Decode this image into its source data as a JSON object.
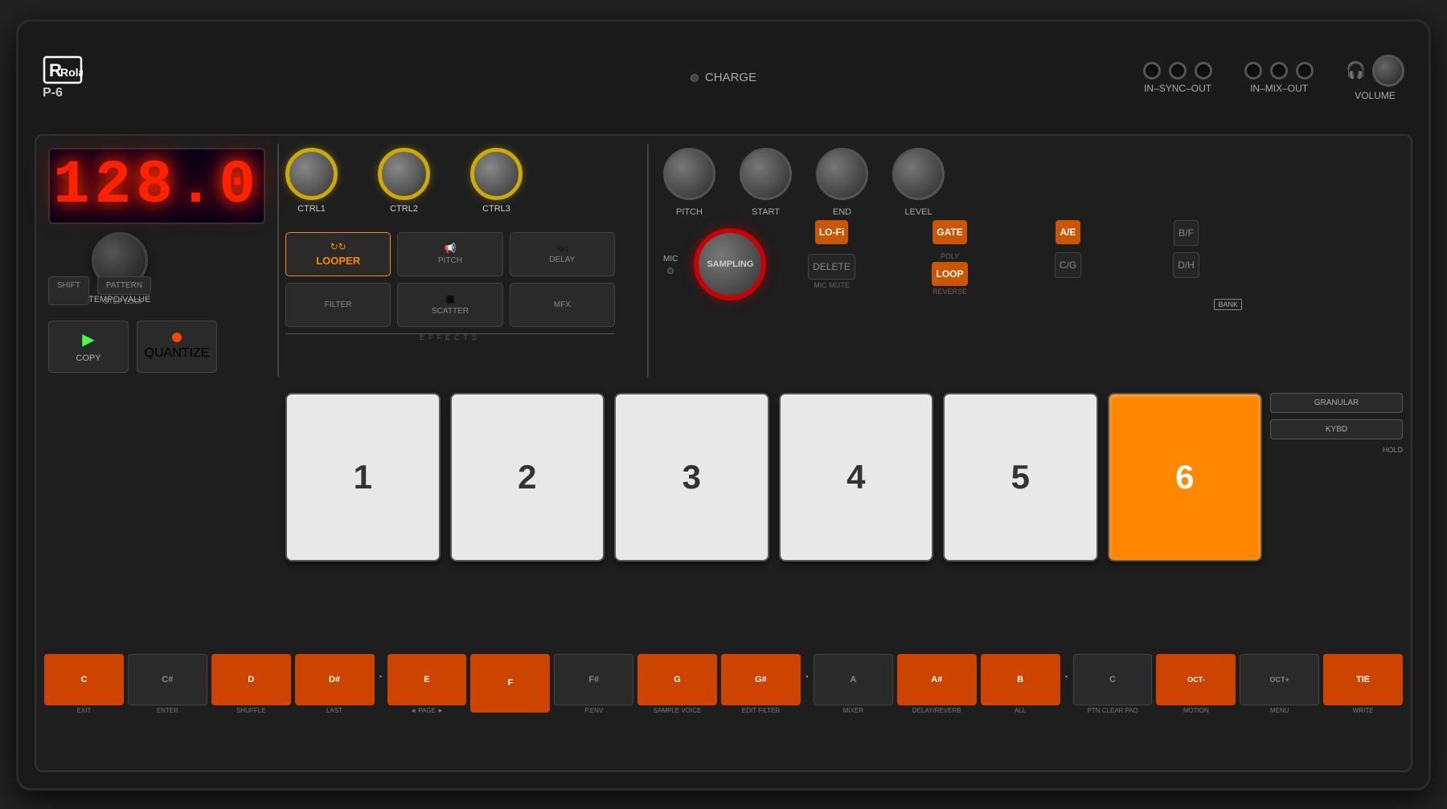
{
  "device": {
    "brand": "Roland",
    "model": "P-6",
    "brand_icon": "R"
  },
  "top_bar": {
    "charge_label": "CHARGE",
    "sync_label": "IN–SYNC–OUT",
    "mix_label": "IN–MIX–OUT",
    "volume_label": "VOLUME"
  },
  "display": {
    "value": "128.0"
  },
  "tempo": {
    "label": "TEMPO/VALUE"
  },
  "buttons": {
    "shift": "SHIFT",
    "pattern": "PATTERN",
    "step_loop": "STEP LOOP",
    "copy": "COPY",
    "quantize": "QUANTIZE"
  },
  "ctrl_knobs": [
    {
      "label": "CTRL1"
    },
    {
      "label": "CTRL2"
    },
    {
      "label": "CTRL3"
    }
  ],
  "effects": {
    "label": "EFFECTS",
    "buttons": [
      {
        "name": "LOOPER",
        "icon": "↻",
        "active": true
      },
      {
        "name": "PITCH",
        "icon": "♪",
        "active": false
      },
      {
        "name": "DELAY",
        "icon": "◁◁",
        "active": false
      },
      {
        "name": "FILTER",
        "icon": "",
        "active": false
      },
      {
        "name": "SCATTER",
        "icon": "▦",
        "active": false
      },
      {
        "name": "MFX",
        "icon": "",
        "active": false
      }
    ]
  },
  "right_knobs": [
    {
      "label": "PITCH",
      "size": "lg"
    },
    {
      "label": "START",
      "size": "lg"
    },
    {
      "label": "END",
      "size": "lg"
    },
    {
      "label": "LEVEL",
      "size": "lg"
    }
  ],
  "mic": {
    "label": "MIC"
  },
  "sampling": {
    "label": "SAMPLING"
  },
  "right_buttons": [
    {
      "label": "LO-Fi",
      "type": "orange",
      "sublabel": ""
    },
    {
      "label": "GATE",
      "type": "orange",
      "sublabel": ""
    },
    {
      "label": "A/E",
      "type": "orange",
      "sublabel": ""
    },
    {
      "label": "B/F",
      "type": "dark",
      "sublabel": ""
    },
    {
      "label": "DELETE",
      "type": "dark",
      "sublabel": "MIC MUTE"
    },
    {
      "label": "LOOP",
      "type": "orange",
      "sublabel": "POLY\nREVERSE"
    },
    {
      "label": "C/G",
      "type": "dark",
      "sublabel": ""
    },
    {
      "label": "D/H",
      "type": "dark",
      "sublabel": ""
    }
  ],
  "pads": [
    {
      "number": "1",
      "active": false
    },
    {
      "number": "2",
      "active": false
    },
    {
      "number": "3",
      "active": false
    },
    {
      "number": "4",
      "active": false
    },
    {
      "number": "5",
      "active": false
    },
    {
      "number": "6",
      "active": true
    }
  ],
  "side_buttons": [
    {
      "label": "GRANULAR"
    },
    {
      "label": "KYBD"
    },
    {
      "label": "HOLD"
    }
  ],
  "bottom_keys": [
    {
      "note": "C",
      "type": "orange",
      "sublabel": "EXIT"
    },
    {
      "note": "C#",
      "type": "dark",
      "sublabel": "ENTER"
    },
    {
      "note": "D",
      "type": "orange",
      "sublabel": "SHUFFLE"
    },
    {
      "note": "D#",
      "type": "orange",
      "sublabel": "LAST"
    },
    {
      "note": "·",
      "type": "dot"
    },
    {
      "note": "E",
      "type": "orange",
      "sublabel": "◄ PAGE"
    },
    {
      "note": "F",
      "type": "orange",
      "sublabel": ""
    },
    {
      "note": "F#",
      "type": "dark",
      "sublabel": "P.ENV"
    },
    {
      "note": "G",
      "type": "orange",
      "sublabel": "SAMPLE VOICE"
    },
    {
      "note": "G#",
      "type": "orange",
      "sublabel": "EDIT FILTER"
    },
    {
      "note": "·",
      "type": "dot"
    },
    {
      "note": "A",
      "type": "dark",
      "sublabel": "MIXER"
    },
    {
      "note": "A#",
      "type": "orange",
      "sublabel": "DELAY/ REVERB"
    },
    {
      "note": "B",
      "type": "orange",
      "sublabel": "ALL"
    },
    {
      "note": "·",
      "type": "dot"
    },
    {
      "note": "C",
      "type": "dark",
      "sublabel": "PTN CLEAR PAD"
    },
    {
      "note": "OCT-",
      "type": "orange",
      "sublabel": "MOTION"
    },
    {
      "note": "OCT+",
      "type": "dark",
      "sublabel": "MENU"
    },
    {
      "note": "TIE",
      "type": "orange",
      "sublabel": "WRITE"
    }
  ]
}
